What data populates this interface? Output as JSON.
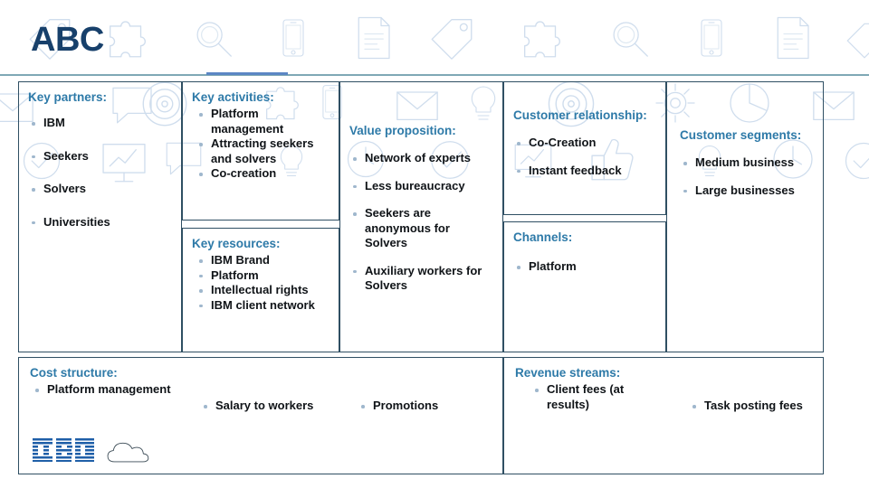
{
  "header": {
    "title": "ABC"
  },
  "colors": {
    "heading": "#2e7aa8",
    "title": "#17406b",
    "body": "#101418",
    "border": "#2f4f63",
    "bullet": "#9fb7cd",
    "rule": "#7fa8b5",
    "rule_accent": "#5b86c4",
    "watermark": "#cfdded"
  },
  "canvas": {
    "key_partners": {
      "title": "Key partners:",
      "items": [
        "IBM",
        "Seekers",
        "Solvers",
        "Universities"
      ]
    },
    "key_activities": {
      "title": "Key activities:",
      "items": [
        "Platform management",
        "Attracting seekers and solvers",
        "Co-creation"
      ]
    },
    "key_resources": {
      "title": "Key resources:",
      "items": [
        "IBM Brand",
        "Platform",
        "Intellectual rights",
        "IBM client network"
      ]
    },
    "value_proposition": {
      "title": "Value proposition:",
      "items": [
        "Network of experts",
        "Less bureaucracy",
        "Seekers are anonymous for Solvers",
        "Auxiliary workers for Solvers"
      ]
    },
    "customer_relationship": {
      "title": "Customer relationship:",
      "items": [
        "Co-Creation",
        "Instant feedback"
      ]
    },
    "channels": {
      "title": "Channels:",
      "items": [
        "Platform"
      ]
    },
    "customer_segments": {
      "title": "Customer segments:",
      "items": [
        "Medium business",
        "Large businesses"
      ]
    },
    "cost_structure": {
      "title": "Cost structure:",
      "items": [
        "Platform management",
        "Salary to workers",
        "Promotions"
      ]
    },
    "revenue_streams": {
      "title": "Revenue streams:",
      "items": [
        "Client fees (at results)",
        "Task posting fees"
      ]
    }
  },
  "footer": {
    "logo_text": "IBM",
    "cloud_label": "cloud-mark"
  },
  "watermark_icons": [
    "tag-icon",
    "puzzle-icon",
    "search-icon",
    "phone-icon",
    "document-icon",
    "tag-icon",
    "puzzle-icon",
    "search-icon",
    "phone-icon",
    "document-icon",
    "envelope-icon",
    "target-icon",
    "gear-icon",
    "piechart-icon",
    "clock-icon",
    "checkmark-icon",
    "lightbulb-icon",
    "chart-icon",
    "thumbsup-icon",
    "speech-icon"
  ]
}
